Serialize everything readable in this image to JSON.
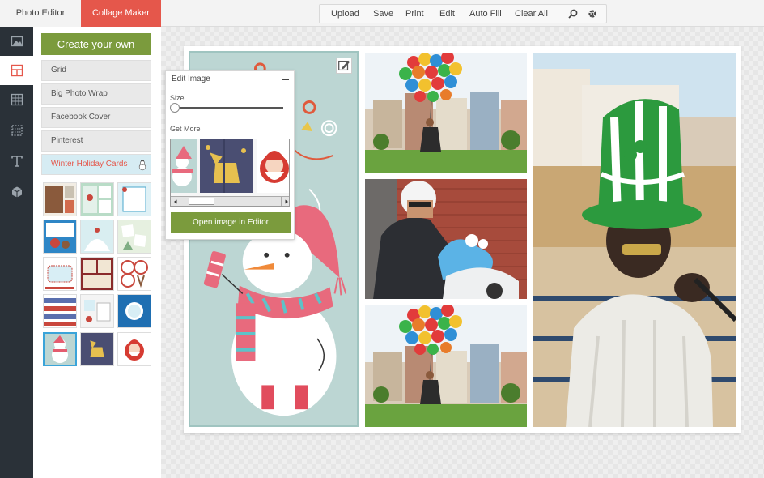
{
  "tabs": {
    "photo_editor": "Photo Editor",
    "collage_maker": "Collage Maker"
  },
  "toolbar": {
    "upload": "Upload",
    "save": "Save",
    "print": "Print",
    "edit": "Edit",
    "auto_fill": "Auto Fill",
    "clear_all": "Clear All",
    "icons": [
      "search-icon",
      "gear-icon"
    ]
  },
  "rail": {
    "items": [
      "image-icon",
      "layout-icon",
      "grid-icon",
      "pattern-icon",
      "text-icon",
      "box-icon"
    ]
  },
  "panel": {
    "create_button": "Create your own",
    "categories": [
      "Grid",
      "Big Photo Wrap",
      "Facebook Cover",
      "Pinterest",
      "Winter Holiday Cards"
    ],
    "active_category": "Winter Holiday Cards"
  },
  "edit_popup": {
    "title": "Edit Image",
    "size_label": "Size",
    "get_more_label": "Get More",
    "open_button": "Open image in Editor",
    "size_value": 0
  },
  "colors": {
    "accent_red": "#e5574b",
    "accent_green": "#7b9b3d",
    "rail_bg": "#2a3138",
    "selected_border": "#3aa4d9"
  }
}
